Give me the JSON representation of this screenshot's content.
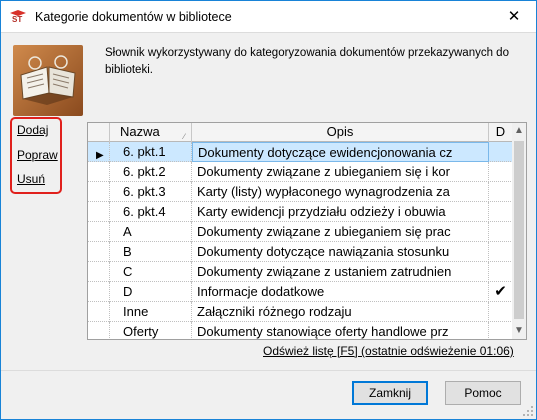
{
  "window": {
    "title": "Kategorie dokumentów w bibliotece",
    "close_glyph": "✕"
  },
  "description": "Słownik wykorzystywany do kategoryzowania dokumentów przekazywanych do biblioteki.",
  "side_links": {
    "add": "Dodaj",
    "edit": "Popraw",
    "delete": "Usuń"
  },
  "grid": {
    "columns": {
      "name": "Nazwa",
      "desc": "Opis",
      "d": "D"
    },
    "rows": [
      {
        "name": "6. pkt.1",
        "desc": "Dokumenty dotyczące ewidencjonowania cz",
        "d": ""
      },
      {
        "name": "6. pkt.2",
        "desc": "Dokumenty związane z ubieganiem się i kor",
        "d": ""
      },
      {
        "name": "6. pkt.3",
        "desc": "Karty (listy) wypłaconego wynagrodzenia za",
        "d": ""
      },
      {
        "name": "6. pkt.4",
        "desc": "Karty ewidencji przydziału odzieży i obuwia",
        "d": ""
      },
      {
        "name": "A",
        "desc": "Dokumenty związane z ubieganiem się prac",
        "d": ""
      },
      {
        "name": "B",
        "desc": "Dokumenty dotyczące nawiązania stosunku",
        "d": ""
      },
      {
        "name": "C",
        "desc": "Dokumenty związane z ustaniem zatrudnien",
        "d": ""
      },
      {
        "name": "D",
        "desc": "Informacje dodatkowe",
        "d": "✔"
      },
      {
        "name": "Inne",
        "desc": "Załączniki różnego rodzaju",
        "d": ""
      },
      {
        "name": "Oferty",
        "desc": "Dokumenty stanowiące oferty handlowe prz",
        "d": ""
      }
    ]
  },
  "refresh_link": "Odśwież listę [F5] (ostatnie odświeżenie 01:06)",
  "buttons": {
    "close": "Zamknij",
    "help": "Pomoc"
  },
  "colors": {
    "selection": "#cce8ff",
    "highlight_border": "#e0201c",
    "default_button_border": "#0078d7"
  },
  "icons": {
    "app": "st-app-icon",
    "logo": "book-library-icon",
    "row_indicator": "current-row-arrow-icon"
  }
}
